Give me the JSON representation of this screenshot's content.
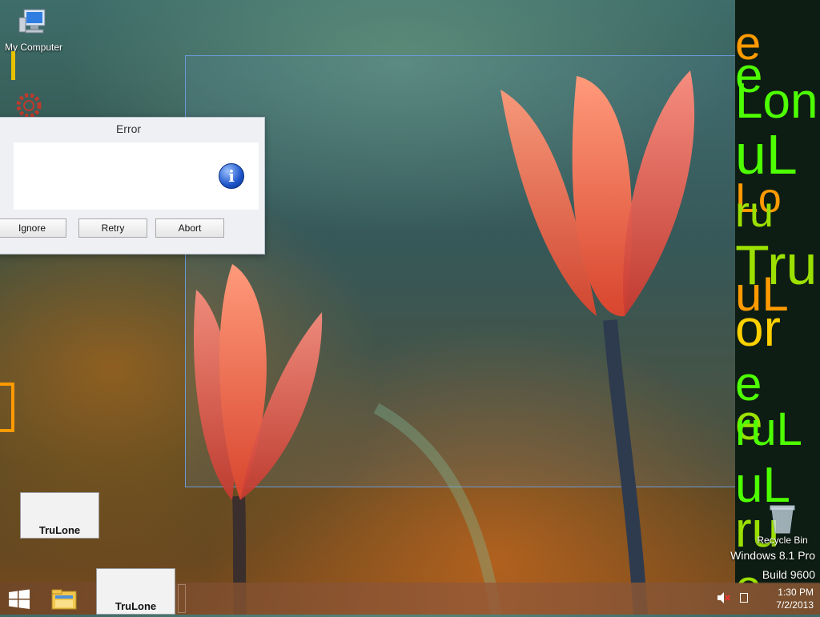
{
  "desktop": {
    "icons": {
      "my_computer": "My Computer",
      "recycle_bin": "Recycle Bin"
    }
  },
  "dialog": {
    "title": "Error",
    "icon": "info-icon",
    "buttons": {
      "ignore": "Ignore",
      "retry": "Retry",
      "abort": "Abort"
    }
  },
  "trulone_windows": {
    "small_label": "TruLone",
    "taskbar_label": "TruLone"
  },
  "tru_column": {
    "words": [
      "e",
      "e",
      "Lon",
      "uL",
      "Lo",
      "ru",
      "Tru",
      "uL",
      "or",
      "e",
      "e",
      "ruL",
      "uL",
      "ru",
      "e"
    ]
  },
  "watermark": {
    "line1": "Windows 8.1 Pro",
    "line2": "Build 9600"
  },
  "taskbar": {
    "clock_time": "1:30 PM",
    "clock_date": "7/2/2013"
  },
  "colors": {
    "tru_green": "#4dff00",
    "tru_lime": "#9be000",
    "tru_orange": "#ff9a00",
    "tru_yellow": "#ffd000"
  }
}
